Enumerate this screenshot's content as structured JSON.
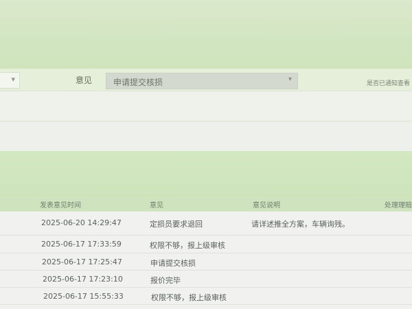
{
  "top_right_text": "",
  "form": {
    "label": "意见",
    "select_value": "申请提交核损",
    "right_label": "是否已通知查看"
  },
  "table": {
    "columns": [
      "发表意见时间",
      "意见",
      "意见说明",
      "处理理赔"
    ],
    "rows": [
      {
        "time": "2025-06-20 14:29:47",
        "opinion": "定损员要求退回",
        "desc": "请详述推全方案，车辆询残。"
      },
      {
        "time": "2025-06-17 17:33:59",
        "opinion": "权限不够，报上级审核",
        "desc": ""
      },
      {
        "time": "2025-06-17 17:25:47",
        "opinion": "申请提交核损",
        "desc": ""
      },
      {
        "time": "2025-06-17 17:23:10",
        "opinion": "报价完毕",
        "desc": ""
      },
      {
        "time": "2025-06-17 15:55:33",
        "opinion": "权限不够，报上级审核",
        "desc": ""
      }
    ]
  }
}
